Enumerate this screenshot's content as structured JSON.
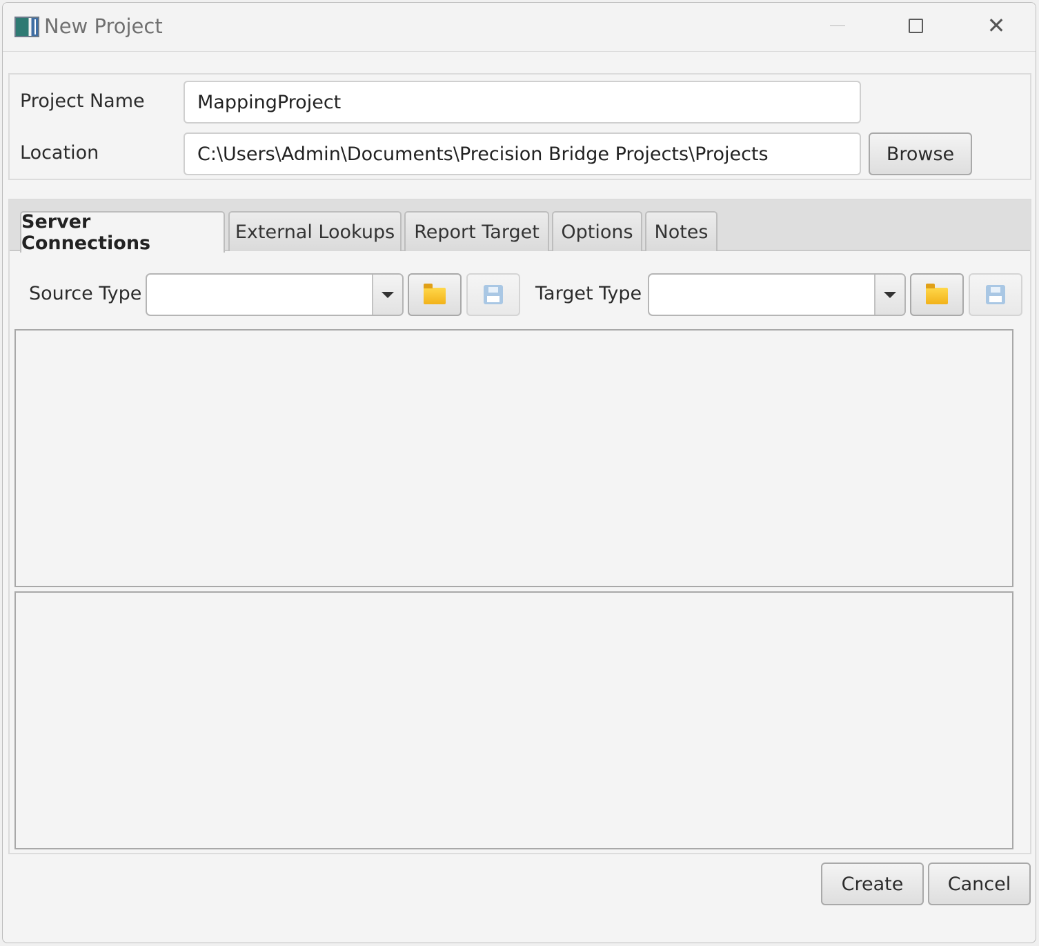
{
  "window": {
    "title": "New Project"
  },
  "project": {
    "name_label": "Project Name",
    "name_value": "MappingProject",
    "location_label": "Location",
    "location_value": "C:\\Users\\Admin\\Documents\\Precision Bridge Projects\\Projects",
    "browse_label": "Browse"
  },
  "tabs": [
    {
      "label": "Server Connections",
      "active": true
    },
    {
      "label": "External Lookups",
      "active": false
    },
    {
      "label": "Report Target",
      "active": false
    },
    {
      "label": "Options",
      "active": false
    },
    {
      "label": "Notes",
      "active": false
    }
  ],
  "server_connections": {
    "source_type_label": "Source Type",
    "source_type_value": "",
    "target_type_label": "Target Type",
    "target_type_value": ""
  },
  "footer": {
    "create_label": "Create",
    "cancel_label": "Cancel"
  },
  "icons": {
    "open": "folder-icon",
    "save": "floppy-disk-icon"
  }
}
